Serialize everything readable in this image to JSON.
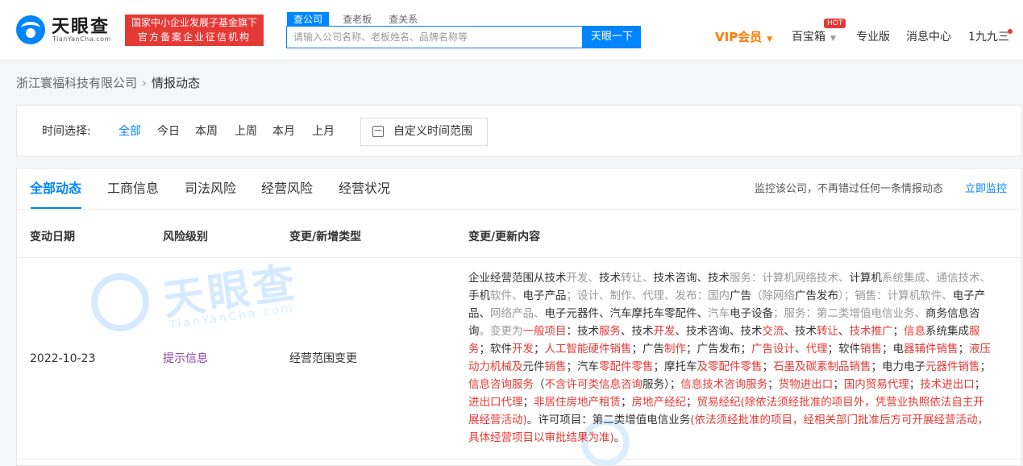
{
  "header": {
    "logo_cn": "天眼查",
    "logo_en": "TianYanCha.com",
    "badge_line1": "国家中小企业发展子基金旗下",
    "badge_line2": "官方备案企业征信机构",
    "search_tabs": [
      "查公司",
      "查老板",
      "查关系"
    ],
    "search_placeholder": "请输入公司名称、老板姓名、品牌名称等",
    "search_button": "天眼一下",
    "nav": {
      "vip": "VIP会员",
      "treasure": "百宝箱",
      "hot": "HOT",
      "pro": "专业版",
      "messages": "消息中心",
      "user": "1九九三"
    }
  },
  "breadcrumb": {
    "company": "浙江寰福科技有限公司",
    "current": "情报动态"
  },
  "time_filter": {
    "label": "时间选择:",
    "options": [
      "全部",
      "今日",
      "本周",
      "上周",
      "本月",
      "上月"
    ],
    "custom": "自定义时间范围"
  },
  "tabs": [
    "全部动态",
    "工商信息",
    "司法风险",
    "经营风险",
    "经营状况"
  ],
  "monitor": {
    "text": "监控该公司，不再错过任何一条情报动态",
    "link": "立即监控"
  },
  "watermark": {
    "cn": "天眼查",
    "en": "TianYanCha.com"
  },
  "table": {
    "headers": [
      "变动日期",
      "风险级别",
      "变更/新增类型",
      "变更/更新内容"
    ],
    "rows": [
      {
        "date": "2022-10-23",
        "risk": "提示信息",
        "type": "经营范围变更",
        "content_segments": [
          {
            "t": "企业经营范围从技术",
            "c": "dark"
          },
          {
            "t": "开发、",
            "c": "gray"
          },
          {
            "t": "技术",
            "c": "dark"
          },
          {
            "t": "转让、",
            "c": "gray"
          },
          {
            "t": "技术咨询、技术",
            "c": "dark"
          },
          {
            "t": "服务：计算机网络技术、",
            "c": "gray"
          },
          {
            "t": "计算机",
            "c": "dark"
          },
          {
            "t": "系统集成、通信技术、",
            "c": "gray"
          },
          {
            "t": "手机",
            "c": "dark"
          },
          {
            "t": "软件、",
            "c": "gray"
          },
          {
            "t": "电子产品",
            "c": "dark"
          },
          {
            "t": "；设计、制作、代理、发布：国内",
            "c": "gray"
          },
          {
            "t": "广告",
            "c": "dark"
          },
          {
            "t": "（除网络",
            "c": "gray"
          },
          {
            "t": "广告发布",
            "c": "dark"
          },
          {
            "t": "）；销售：计算机软件、",
            "c": "gray"
          },
          {
            "t": "电子产品、",
            "c": "dark"
          },
          {
            "t": "网络产品、",
            "c": "gray"
          },
          {
            "t": "电子元器件、汽车摩托车零配件、",
            "c": "dark"
          },
          {
            "t": "汽车",
            "c": "gray"
          },
          {
            "t": "电子设备",
            "c": "dark"
          },
          {
            "t": "；服务：第二类增值电信业务、",
            "c": "gray"
          },
          {
            "t": "商务信息咨询",
            "c": "dark"
          },
          {
            "t": "。变更为",
            "c": "gray"
          },
          {
            "t": "一般项目",
            "c": "red"
          },
          {
            "t": "：技术",
            "c": "dark"
          },
          {
            "t": "服务",
            "c": "red"
          },
          {
            "t": "、技术",
            "c": "dark"
          },
          {
            "t": "开发",
            "c": "red"
          },
          {
            "t": "、技术咨询、技术",
            "c": "dark"
          },
          {
            "t": "交流",
            "c": "red"
          },
          {
            "t": "、技术",
            "c": "dark"
          },
          {
            "t": "转让",
            "c": "red"
          },
          {
            "t": "、",
            "c": "dark"
          },
          {
            "t": "技术推广",
            "c": "red"
          },
          {
            "t": "；",
            "c": "dark"
          },
          {
            "t": "信息",
            "c": "red"
          },
          {
            "t": "系统集成",
            "c": "dark"
          },
          {
            "t": "服务",
            "c": "red"
          },
          {
            "t": "；软件",
            "c": "dark"
          },
          {
            "t": "开发",
            "c": "red"
          },
          {
            "t": "；",
            "c": "dark"
          },
          {
            "t": "人工智能硬件销售",
            "c": "red"
          },
          {
            "t": "；广告",
            "c": "dark"
          },
          {
            "t": "制作",
            "c": "red"
          },
          {
            "t": "；广告发布；",
            "c": "dark"
          },
          {
            "t": "广告设计",
            "c": "red"
          },
          {
            "t": "、",
            "c": "dark"
          },
          {
            "t": "代理",
            "c": "red"
          },
          {
            "t": "；软件",
            "c": "dark"
          },
          {
            "t": "销售",
            "c": "red"
          },
          {
            "t": "；电",
            "c": "dark"
          },
          {
            "t": "器辅件销售",
            "c": "red"
          },
          {
            "t": "；",
            "c": "dark"
          },
          {
            "t": "液压动力机械及",
            "c": "red"
          },
          {
            "t": "元件",
            "c": "dark"
          },
          {
            "t": "销售",
            "c": "red"
          },
          {
            "t": "；汽车",
            "c": "dark"
          },
          {
            "t": "零配件零售",
            "c": "red"
          },
          {
            "t": "；摩托车",
            "c": "dark"
          },
          {
            "t": "及零配件零售",
            "c": "red"
          },
          {
            "t": "；",
            "c": "dark"
          },
          {
            "t": "石墨及碳素制品销售",
            "c": "red"
          },
          {
            "t": "；电力电子",
            "c": "dark"
          },
          {
            "t": "元器件销售",
            "c": "red"
          },
          {
            "t": "；",
            "c": "dark"
          },
          {
            "t": "信息咨询服务",
            "c": "red"
          },
          {
            "t": "（",
            "c": "dark"
          },
          {
            "t": "不含许可类信息咨询",
            "c": "red"
          },
          {
            "t": "服务）；",
            "c": "dark"
          },
          {
            "t": "信息技术咨询服务",
            "c": "red"
          },
          {
            "t": "；",
            "c": "dark"
          },
          {
            "t": "货物进出口",
            "c": "red"
          },
          {
            "t": "；",
            "c": "dark"
          },
          {
            "t": "国内贸易代理",
            "c": "red"
          },
          {
            "t": "；",
            "c": "dark"
          },
          {
            "t": "技术进出口",
            "c": "red"
          },
          {
            "t": "；",
            "c": "dark"
          },
          {
            "t": "进出口代理",
            "c": "red"
          },
          {
            "t": "；",
            "c": "dark"
          },
          {
            "t": "非居住房地产租赁",
            "c": "red"
          },
          {
            "t": "；",
            "c": "dark"
          },
          {
            "t": "房地产经纪",
            "c": "red"
          },
          {
            "t": "；",
            "c": "dark"
          },
          {
            "t": "贸易经纪(除依法须经批准的项目外，凭营业执照依法自主开展经营活动)",
            "c": "red"
          },
          {
            "t": "。许可项目：第二类增值电信业务",
            "c": "dark"
          },
          {
            "t": "(依法须经批准的项目，经相关部门批准后方可开展经营活动，具体经营项目以审批结果为准)",
            "c": "red"
          },
          {
            "t": "。",
            "c": "dark"
          }
        ]
      }
    ]
  }
}
